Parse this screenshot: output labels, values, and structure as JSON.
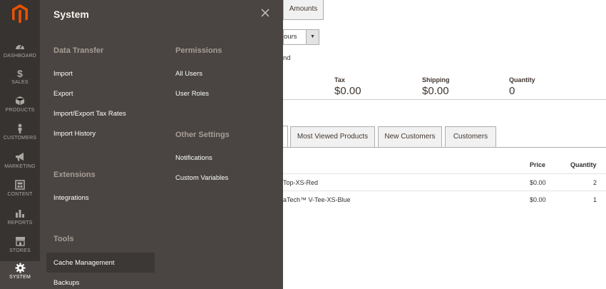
{
  "nav": {
    "items": [
      {
        "label": "DASHBOARD",
        "icon": "dashboard-gauge-icon"
      },
      {
        "label": "SALES",
        "icon": "dollar-icon"
      },
      {
        "label": "PRODUCTS",
        "icon": "cube-icon"
      },
      {
        "label": "CUSTOMERS",
        "icon": "person-icon"
      },
      {
        "label": "MARKETING",
        "icon": "megaphone-icon"
      },
      {
        "label": "CONTENT",
        "icon": "layout-icon"
      },
      {
        "label": "REPORTS",
        "icon": "bar-chart-icon"
      },
      {
        "label": "STORES",
        "icon": "storefront-icon"
      },
      {
        "label": "SYSTEM",
        "icon": "gear-icon"
      }
    ],
    "active": "SYSTEM",
    "colors": {
      "bg": "#373330",
      "active_bg": "#4a4542",
      "logo": "#eb5202"
    }
  },
  "panel": {
    "title": "System",
    "data_transfer": {
      "title": "Data Transfer",
      "links": [
        "Import",
        "Export",
        "Import/Export Tax Rates",
        "Import History"
      ]
    },
    "extensions": {
      "title": "Extensions",
      "links": [
        "Integrations"
      ]
    },
    "tools": {
      "title": "Tools",
      "links": [
        "Cache Management",
        "Backups"
      ]
    },
    "permissions": {
      "title": "Permissions",
      "links": [
        "All Users",
        "User Roles"
      ]
    },
    "other_settings": {
      "title": "Other Settings",
      "links": [
        "Notifications",
        "Custom Variables"
      ]
    }
  },
  "dashboard": {
    "amounts_tab": "Amounts",
    "period_select": "ours",
    "refresh_fragment": "nd",
    "stats": [
      {
        "label": "Tax",
        "value": "$0.00"
      },
      {
        "label": "Shipping",
        "value": "$0.00"
      },
      {
        "label": "Quantity",
        "value": "0"
      }
    ],
    "tabs": [
      "Most Viewed Products",
      "New Customers",
      "Customers"
    ],
    "table": {
      "headers": [
        "Price",
        "Quantity"
      ],
      "rows": [
        {
          "product": "Top-XS-Red",
          "price": "$0.00",
          "quantity": "2"
        },
        {
          "product": "aTech™ V-Tee-XS-Blue",
          "price": "$0.00",
          "quantity": "1"
        }
      ]
    }
  }
}
